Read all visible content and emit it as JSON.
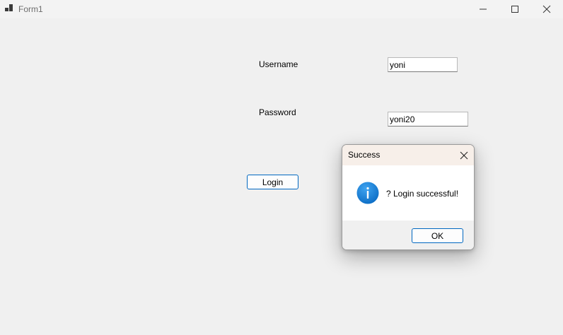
{
  "window": {
    "title": "Form1",
    "icons": {
      "app": "app-icon",
      "minimize": "minimize-icon",
      "maximize": "maximize-icon",
      "close": "close-icon"
    }
  },
  "form": {
    "username_label": "Username",
    "username_value": "yoni",
    "password_label": "Password",
    "password_value": "yoni20",
    "login_label": "Login"
  },
  "dialog": {
    "title": "Success",
    "message": "? Login successful!",
    "ok_label": "OK",
    "icon": "info-icon",
    "icon_color": "#0e7ad1"
  },
  "colors": {
    "accent": "#0067c0",
    "window_bg": "#f0f0f0",
    "dialog_titlebar_bg": "#f7efe9"
  }
}
